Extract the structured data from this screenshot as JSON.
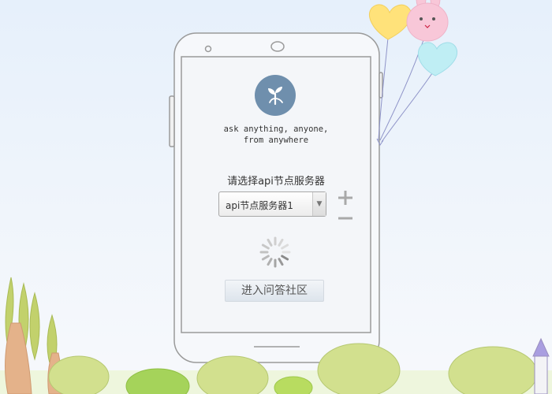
{
  "slogan": {
    "line1": "ask anything, anyone,",
    "line2": "from anywhere"
  },
  "server": {
    "label": "请选择api节点服务器",
    "selected": "api节点服务器1",
    "add_icon": "plus-icon",
    "remove_icon": "minus-icon"
  },
  "loading": {
    "icon": "spinner-icon"
  },
  "enter_button": {
    "label": "进入问答社区"
  },
  "logo": {
    "icon": "sprout-logo-icon"
  },
  "colors": {
    "logo_bg": "#6f8fad",
    "phone_outline": "#9a9a9a",
    "balloon_yellow": "#ffe27a",
    "balloon_pink": "#f8c7d8",
    "balloon_blue": "#bfeef4",
    "bush_green": "#c9dc8c"
  }
}
